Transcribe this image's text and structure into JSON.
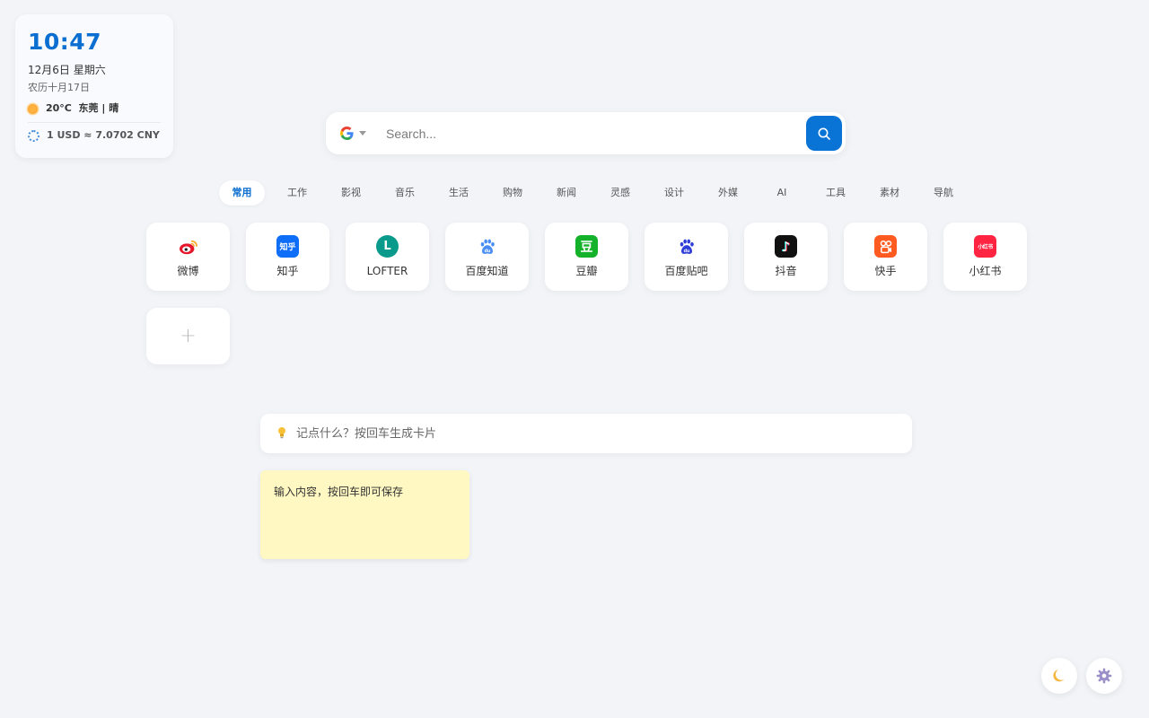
{
  "widget": {
    "time": "10:47",
    "date": "12月6日 星期六",
    "lunar": "农历十月17日",
    "weather": "20°C  东莞 | 晴",
    "rate": "1 USD ≈ 7.0702 CNY"
  },
  "search": {
    "engine_icon": "google-icon",
    "placeholder": "Search...",
    "value": ""
  },
  "tabs": [
    "常用",
    "工作",
    "影视",
    "音乐",
    "生活",
    "购物",
    "新闻",
    "灵感",
    "设计",
    "外媒",
    "AI",
    "工具",
    "素材",
    "导航"
  ],
  "active_tab": "常用",
  "shortcuts": [
    {
      "label": "微博",
      "icon": "weibo-icon",
      "color": "#ffffff"
    },
    {
      "label": "知乎",
      "icon": "zhihu-icon",
      "text": "知乎",
      "color": "#0f6ef7"
    },
    {
      "label": "LOFTER",
      "icon": "lofter-icon",
      "text": "L",
      "color": "#0a9a8c"
    },
    {
      "label": "百度知道",
      "icon": "baidu-zhidao-icon",
      "color": "#ffffff"
    },
    {
      "label": "豆瓣",
      "icon": "douban-icon",
      "text": "豆",
      "color": "#14b12a"
    },
    {
      "label": "百度贴吧",
      "icon": "baidu-tieba-icon",
      "color": "#ffffff"
    },
    {
      "label": "抖音",
      "icon": "douyin-icon",
      "text": "♪",
      "color": "#111111"
    },
    {
      "label": "快手",
      "icon": "kuaishou-icon",
      "color": "#ff5a1f"
    },
    {
      "label": "小红书",
      "icon": "xiaohongshu-icon",
      "text": "小红书",
      "color": "#ff2442"
    }
  ],
  "add_shortcut": "+",
  "note": {
    "icon": "lightbulb-icon",
    "placeholder": "记点什么？按回车生成卡片",
    "card_text": "输入内容，按回车即可保存"
  },
  "fabs": {
    "theme_icon": "moon-icon",
    "settings_icon": "gear-icon"
  }
}
